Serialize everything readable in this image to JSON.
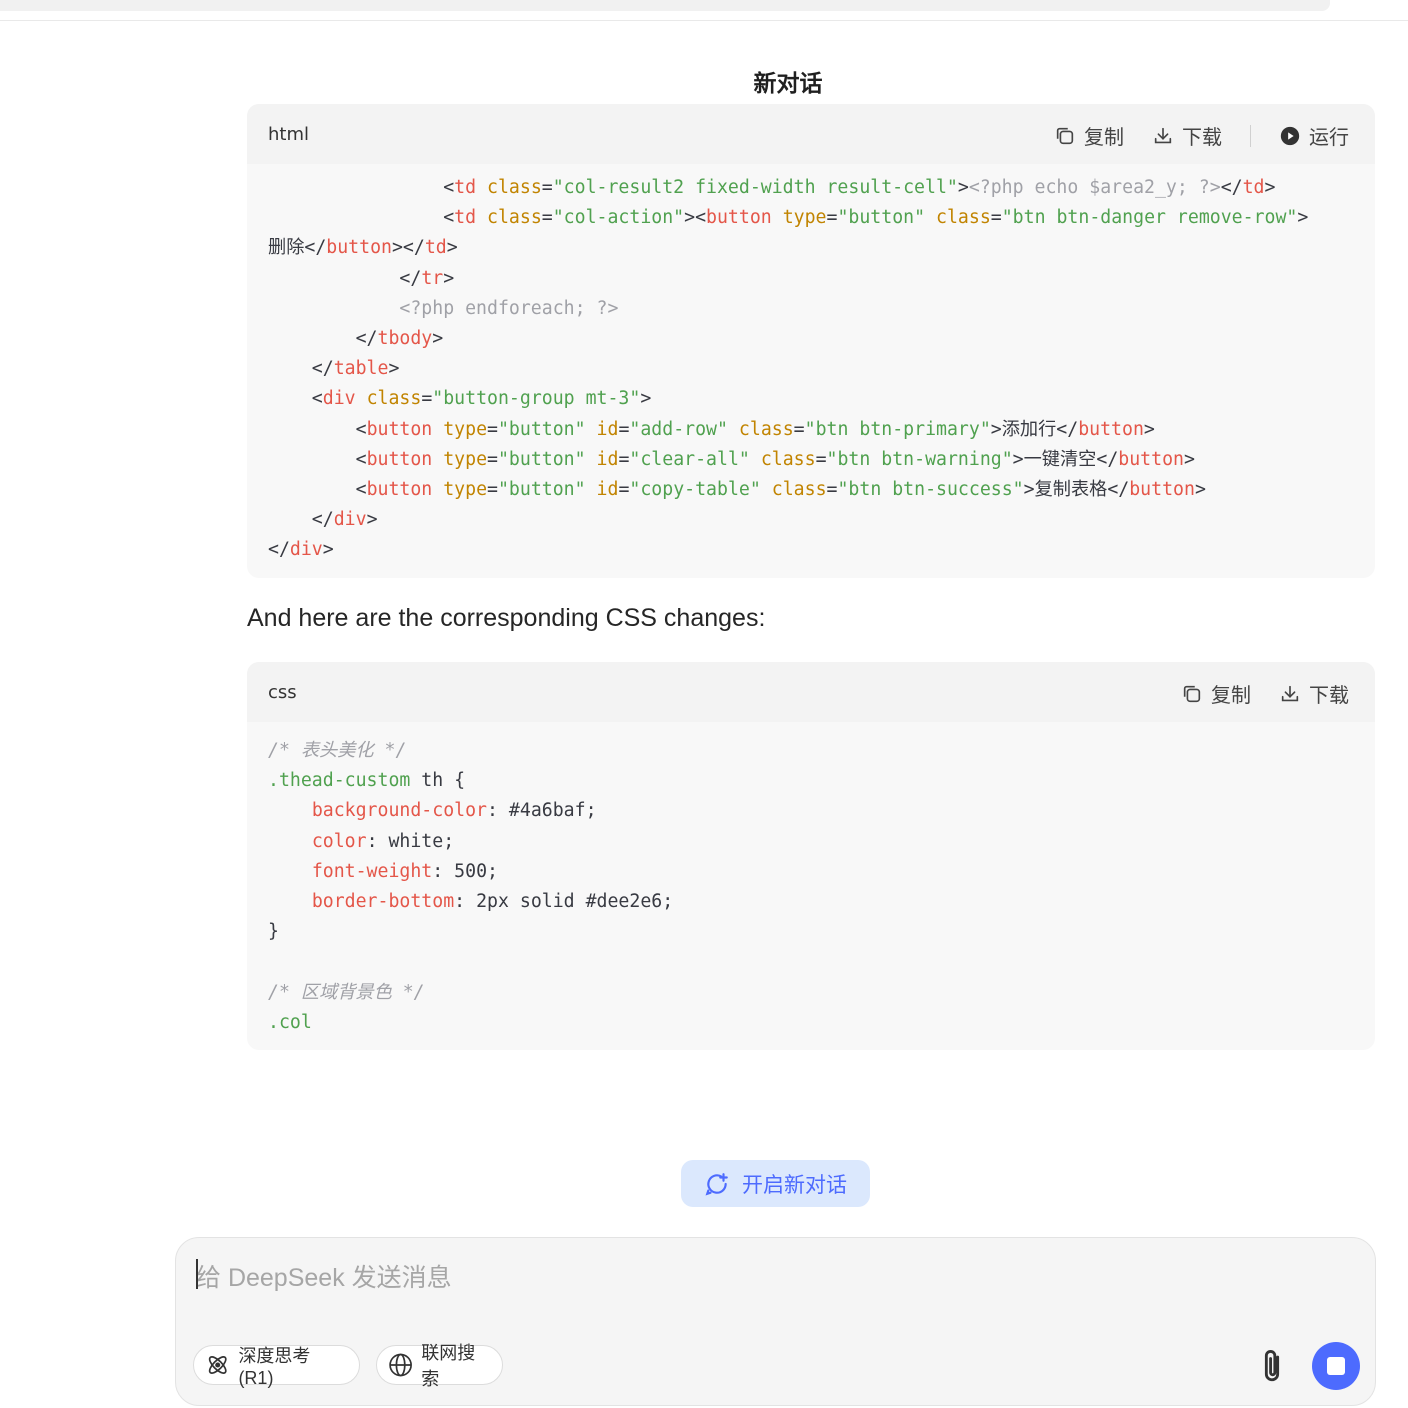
{
  "conversation": {
    "title": "新对话"
  },
  "html_block": {
    "lang": "html",
    "copy_label": "复制",
    "download_label": "下载",
    "run_label": "运行",
    "code": "                <td class=\"col-result2 fixed-width result-cell\"><?php echo $area2_y; ?></td>\n                <td class=\"col-action\"><button type=\"button\" class=\"btn btn-danger remove-row\">\n删除</button></td>\n            </tr>\n            <?php endforeach; ?>\n        </tbody>\n    </table>\n    <div class=\"button-group mt-3\">\n        <button type=\"button\" id=\"add-row\" class=\"btn btn-primary\">添加行</button>\n        <button type=\"button\" id=\"clear-all\" class=\"btn btn-warning\">一键清空</button>\n        <button type=\"button\" id=\"copy-table\" class=\"btn btn-success\">复制表格</button>\n    </div>\n</div>"
  },
  "message": {
    "text": "And here are the corresponding CSS changes:"
  },
  "css_block": {
    "lang": "css",
    "copy_label": "复制",
    "download_label": "下载",
    "code": "/* 表头美化 */\n.thead-custom th {\n    background-color: #4a6baf;\n    color: white;\n    font-weight: 500;\n    border-bottom: 2px solid #dee2e6;\n}\n\n/* 区域背景色 */\n.col"
  },
  "new_chat": {
    "label": "开启新对话"
  },
  "composer": {
    "placeholder": "给 DeepSeek 发送消息",
    "deep_think_label": "深度思考 (R1)",
    "web_search_label": "联网搜索"
  },
  "colors": {
    "accent": "#4d6bfe",
    "new_chat_bg": "#dbe8fd"
  }
}
